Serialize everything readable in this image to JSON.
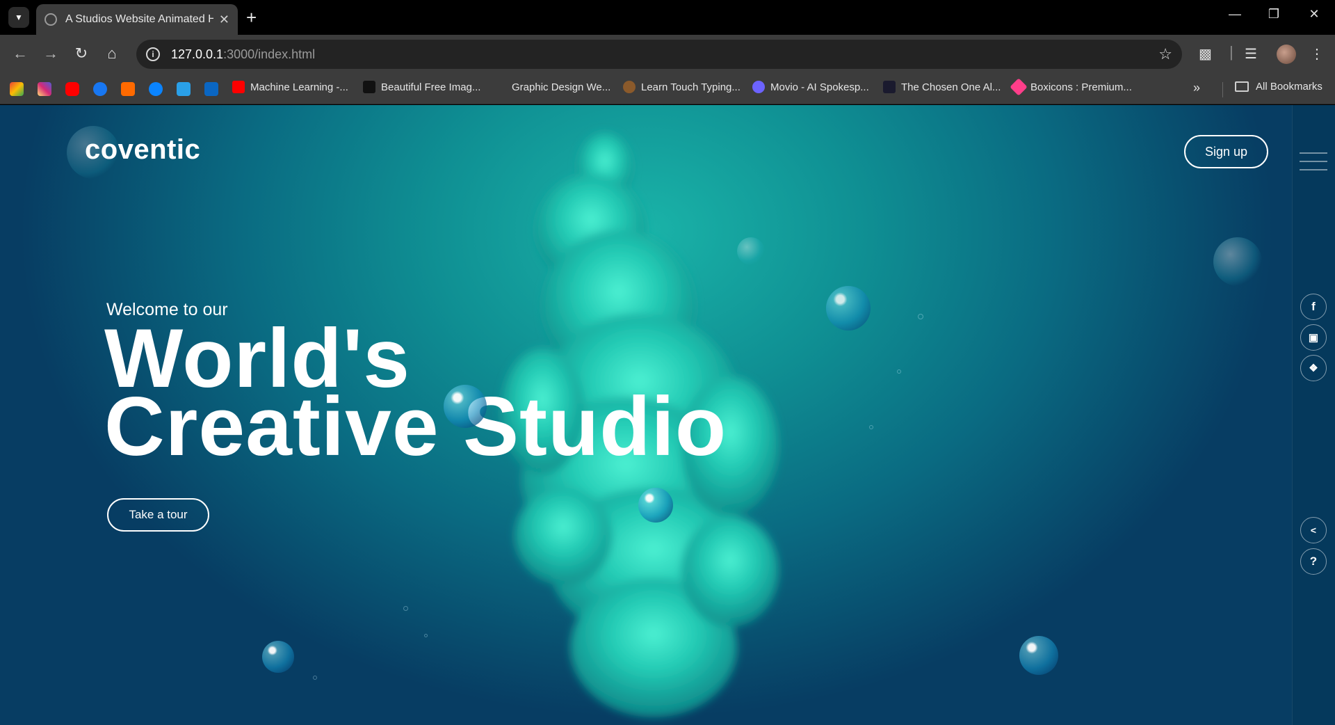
{
  "browser": {
    "tab_title": "A Studios Website Animated Hom",
    "url_host": "127.0.0.1",
    "url_path": ":3000/index.html",
    "bookmarks": [
      {
        "label": "Machine Learning -...",
        "color": "#ff0000"
      },
      {
        "label": "Beautiful Free Imag...",
        "color": "#111111"
      },
      {
        "label": "Graphic Design We...",
        "color": "#3c3c3c"
      },
      {
        "label": "Learn Touch Typing...",
        "color": "#8b5a2b"
      },
      {
        "label": "Movio - AI Spokesp...",
        "color": "#6c63ff"
      },
      {
        "label": "The Chosen One Al...",
        "color": "#1a1a2e"
      },
      {
        "label": "Boxicons : Premium...",
        "color": "#ff3e8a"
      }
    ],
    "all_bookmarks": "All Bookmarks"
  },
  "site": {
    "logo": "coventic",
    "signup": "Sign up",
    "welcome": "Welcome to our",
    "headline_line1": "World's",
    "headline_line2": "Creative Studio",
    "cta": "Take a tour",
    "social_icons": [
      "facebook-icon",
      "instagram-icon",
      "twitter-icon"
    ],
    "accent_color": "#0f8f93"
  }
}
